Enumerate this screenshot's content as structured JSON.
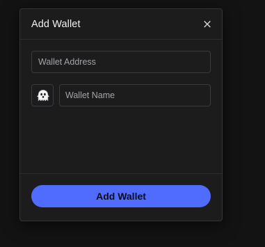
{
  "modal": {
    "title": "Add Wallet",
    "close_symbol": "×"
  },
  "form": {
    "address_placeholder": "Wallet Address",
    "address_value": "",
    "name_placeholder": "Wallet Name",
    "name_value": "",
    "emoji_icon": "ghost-icon"
  },
  "footer": {
    "submit_label": "Add Wallet"
  },
  "colors": {
    "accent": "#4f6cff",
    "modal_bg": "#1c1c1d",
    "page_bg": "#131313"
  }
}
